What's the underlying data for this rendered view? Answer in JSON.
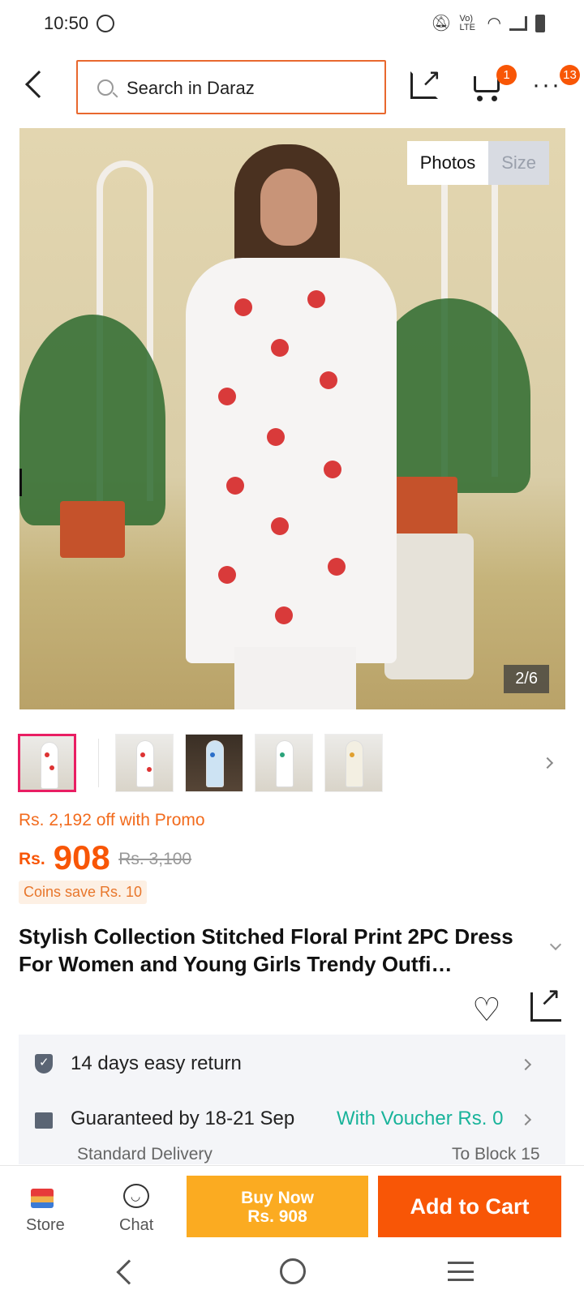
{
  "status_bar": {
    "time": "10:50",
    "icons": [
      "whatsapp-icon",
      "mute-icon",
      "volte-icon",
      "wifi-icon",
      "signal-icon",
      "battery-icon"
    ],
    "volte_label": "Vo) LTE"
  },
  "top_nav": {
    "search_placeholder": "Search in Daraz",
    "cart_badge": "1",
    "more_badge": "13",
    "accent_color": "#e8682e"
  },
  "gallery": {
    "tab_photos": "Photos",
    "tab_size": "Size",
    "counter": "2/6",
    "thumbnail_count": 5,
    "selected_index": 0
  },
  "product": {
    "promo_text": "Rs. 2,192 off with Promo",
    "currency": "Rs.",
    "price": "908",
    "original_price": "Rs. 3,100",
    "coins_text": "Coins save Rs. 10",
    "title": "Stylish Collection Stitched Floral Print 2PC Dress For Women and Young Girls Trendy Outfi…",
    "price_color": "#f85606"
  },
  "delivery": {
    "return_text": "14 days easy return",
    "guarantee_text": "Guaranteed by 18-21 Sep",
    "voucher_text": "With Voucher Rs. 0",
    "delivery_type": "Standard Delivery",
    "location": "To Block 15"
  },
  "bottom_bar": {
    "store_label": "Store",
    "chat_label": "Chat",
    "buy_now_label": "Buy Now",
    "buy_now_price": "Rs. 908",
    "add_to_cart_label": "Add to Cart",
    "buy_color": "#fbab21",
    "cart_color": "#f85606"
  }
}
